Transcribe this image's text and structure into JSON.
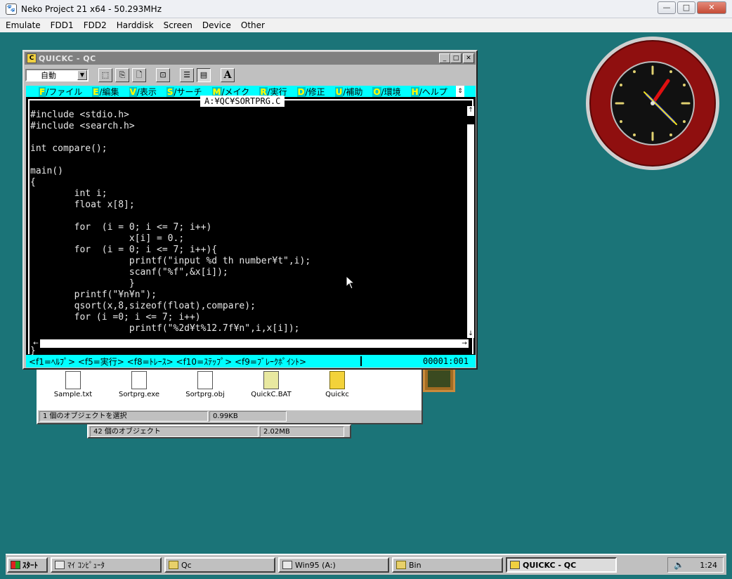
{
  "host": {
    "title": "Neko Project 21 x64 - 50.293MHz",
    "menu": [
      "Emulate",
      "FDD1",
      "FDD2",
      "Harddisk",
      "Screen",
      "Device",
      "Other"
    ]
  },
  "explorer": {
    "files": [
      {
        "name": "Sample.txt",
        "icon": "text-file-icon"
      },
      {
        "name": "Sortprg.exe",
        "icon": "exe-file-icon"
      },
      {
        "name": "Sortprg.obj",
        "icon": "obj-file-icon"
      },
      {
        "name": "QuickC.BAT",
        "icon": "bat-file-icon"
      },
      {
        "name": "Quickc",
        "icon": "shortcut-icon"
      }
    ],
    "status_selection": "1 個のオブジェクトを選択",
    "status_size": "0.99KB"
  },
  "explorer2": {
    "status_count": "42 個のオブジェクト",
    "status_size": "2.02MB"
  },
  "qc": {
    "title": "QUICKC - QC",
    "font_select": "自動",
    "toolbar": [
      "⬚",
      "⎘",
      "🗋",
      "⊡",
      "☰",
      "▤",
      "A"
    ],
    "menu": [
      {
        "key": "F",
        "label": "/ファイル"
      },
      {
        "key": "E",
        "label": "/編集"
      },
      {
        "key": "V",
        "label": "/表示"
      },
      {
        "key": "S",
        "label": "/サーチ"
      },
      {
        "key": "M",
        "label": "/メイク"
      },
      {
        "key": "R",
        "label": "/実行"
      },
      {
        "key": "D",
        "label": "/修正"
      },
      {
        "key": "U",
        "label": "/補助"
      },
      {
        "key": "O",
        "label": "/環境"
      },
      {
        "key": "H",
        "label": "/ヘルプ"
      }
    ],
    "file_tab": "A:¥QC¥SORTPRG.C",
    "code_lines": [
      "#include <stdio.h>",
      "#include <search.h>",
      "",
      "int compare();",
      "",
      "main()",
      "{",
      "        int i;",
      "        float x[8];",
      "",
      "        for  (i = 0; i <= 7; i++)",
      "                  x[i] = 0.;",
      "        for  (i = 0; i <= 7; i++){",
      "                  printf(\"input %d th number¥t\",i);",
      "                  scanf(\"%f\",&x[i]);",
      "                  }",
      "        printf(\"¥n¥n\");",
      "        qsort(x,8,sizeof(float),compare);",
      "        for (i =0; i <= 7; i++)",
      "                  printf(\"%2d¥t%12.7f¥n\",i,x[i]);"
    ],
    "last_line": "}",
    "status_keys": "<f1=ﾍﾙﾌﾟ> <f5=実行> <f8=ﾄﾚｰｽ> <f10=ｽﾃｯﾌﾟ> <f9=ﾌﾞﾚｰｸﾎﾟｲﾝﾄ>",
    "status_pos": "00001:001"
  },
  "taskbar": {
    "start": "ｽﾀｰﾄ",
    "tasks": [
      {
        "label": "ﾏｲ ｺﾝﾋﾟｭｰﾀ",
        "icon": "computer-icon",
        "active": false
      },
      {
        "label": "Qc",
        "icon": "folder-icon",
        "active": false
      },
      {
        "label": "Win95 (A:)",
        "icon": "drive-icon",
        "active": false
      },
      {
        "label": "Bin",
        "icon": "folder-icon",
        "active": false
      },
      {
        "label": "QUICKC - QC",
        "icon": "quickc-icon",
        "active": true
      }
    ],
    "clock": "1:24"
  },
  "colors": {
    "desktop": "#1b7478",
    "console_bg": "#000000",
    "console_bar": "#00ffff",
    "hotkey": "#ffff00",
    "clock_ring": "#8f0f0f"
  }
}
